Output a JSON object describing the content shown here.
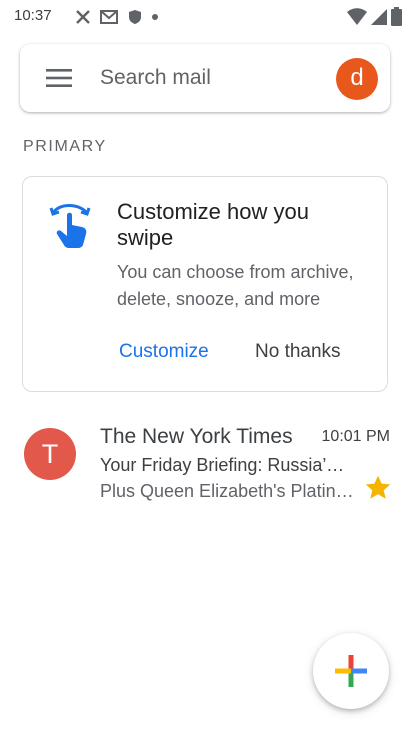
{
  "status_bar": {
    "time": "10:37",
    "left_icons": [
      "x-notification-icon",
      "gmail-notification-icon",
      "shield-icon",
      "dot-icon"
    ],
    "right_icons": [
      "wifi-icon",
      "cellular-signal-icon",
      "battery-icon"
    ]
  },
  "search": {
    "placeholder": "Search mail",
    "avatar_letter": "d",
    "avatar_color": "#e8571c"
  },
  "section": {
    "label": "PRIMARY"
  },
  "promo": {
    "title": "Customize how you swipe",
    "description": "You can choose from archive, delete, snooze, and more",
    "customize_label": "Customize",
    "dismiss_label": "No thanks",
    "accent_color": "#1a73e8"
  },
  "emails": [
    {
      "avatar_letter": "T",
      "avatar_color": "#e2584a",
      "sender": "The New York Times",
      "time": "10:01 PM",
      "subject": "Your Friday Briefing: Russia’s war in Ukraine",
      "snippet": "Plus Queen Elizabeth's Platinum Jubilee.",
      "starred": true,
      "star_color": "#f4b400"
    }
  ],
  "fab": {
    "icon": "compose-plus-icon"
  }
}
